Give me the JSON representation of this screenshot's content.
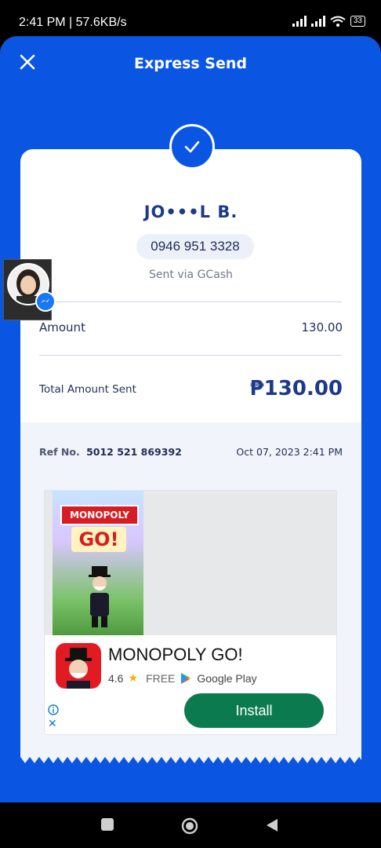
{
  "status_bar": {
    "time_net": "2:41 PM | 57.6KB/s",
    "battery": "33"
  },
  "header": {
    "title": "Express Send"
  },
  "receipt": {
    "recipient_name": "JO•••L B.",
    "phone": "0946 951 3328",
    "via": "Sent via GCash",
    "amount_label": "Amount",
    "amount_value": "130.00",
    "total_label": "Total Amount Sent",
    "total_value": "₱130.00",
    "ref_label": "Ref No.",
    "ref_number": "5012 521 869392",
    "date": "Oct 07, 2023 2:41 PM"
  },
  "ad": {
    "banner_line1": "MONOPOLY",
    "banner_line2": "GO!",
    "app_name": "MONOPOLY GO!",
    "rating": "4.6",
    "price": "FREE",
    "store": "Google Play",
    "install_label": "Install"
  },
  "colors": {
    "brand_blue": "#0a56e3",
    "install_green": "#0c7a4f"
  }
}
